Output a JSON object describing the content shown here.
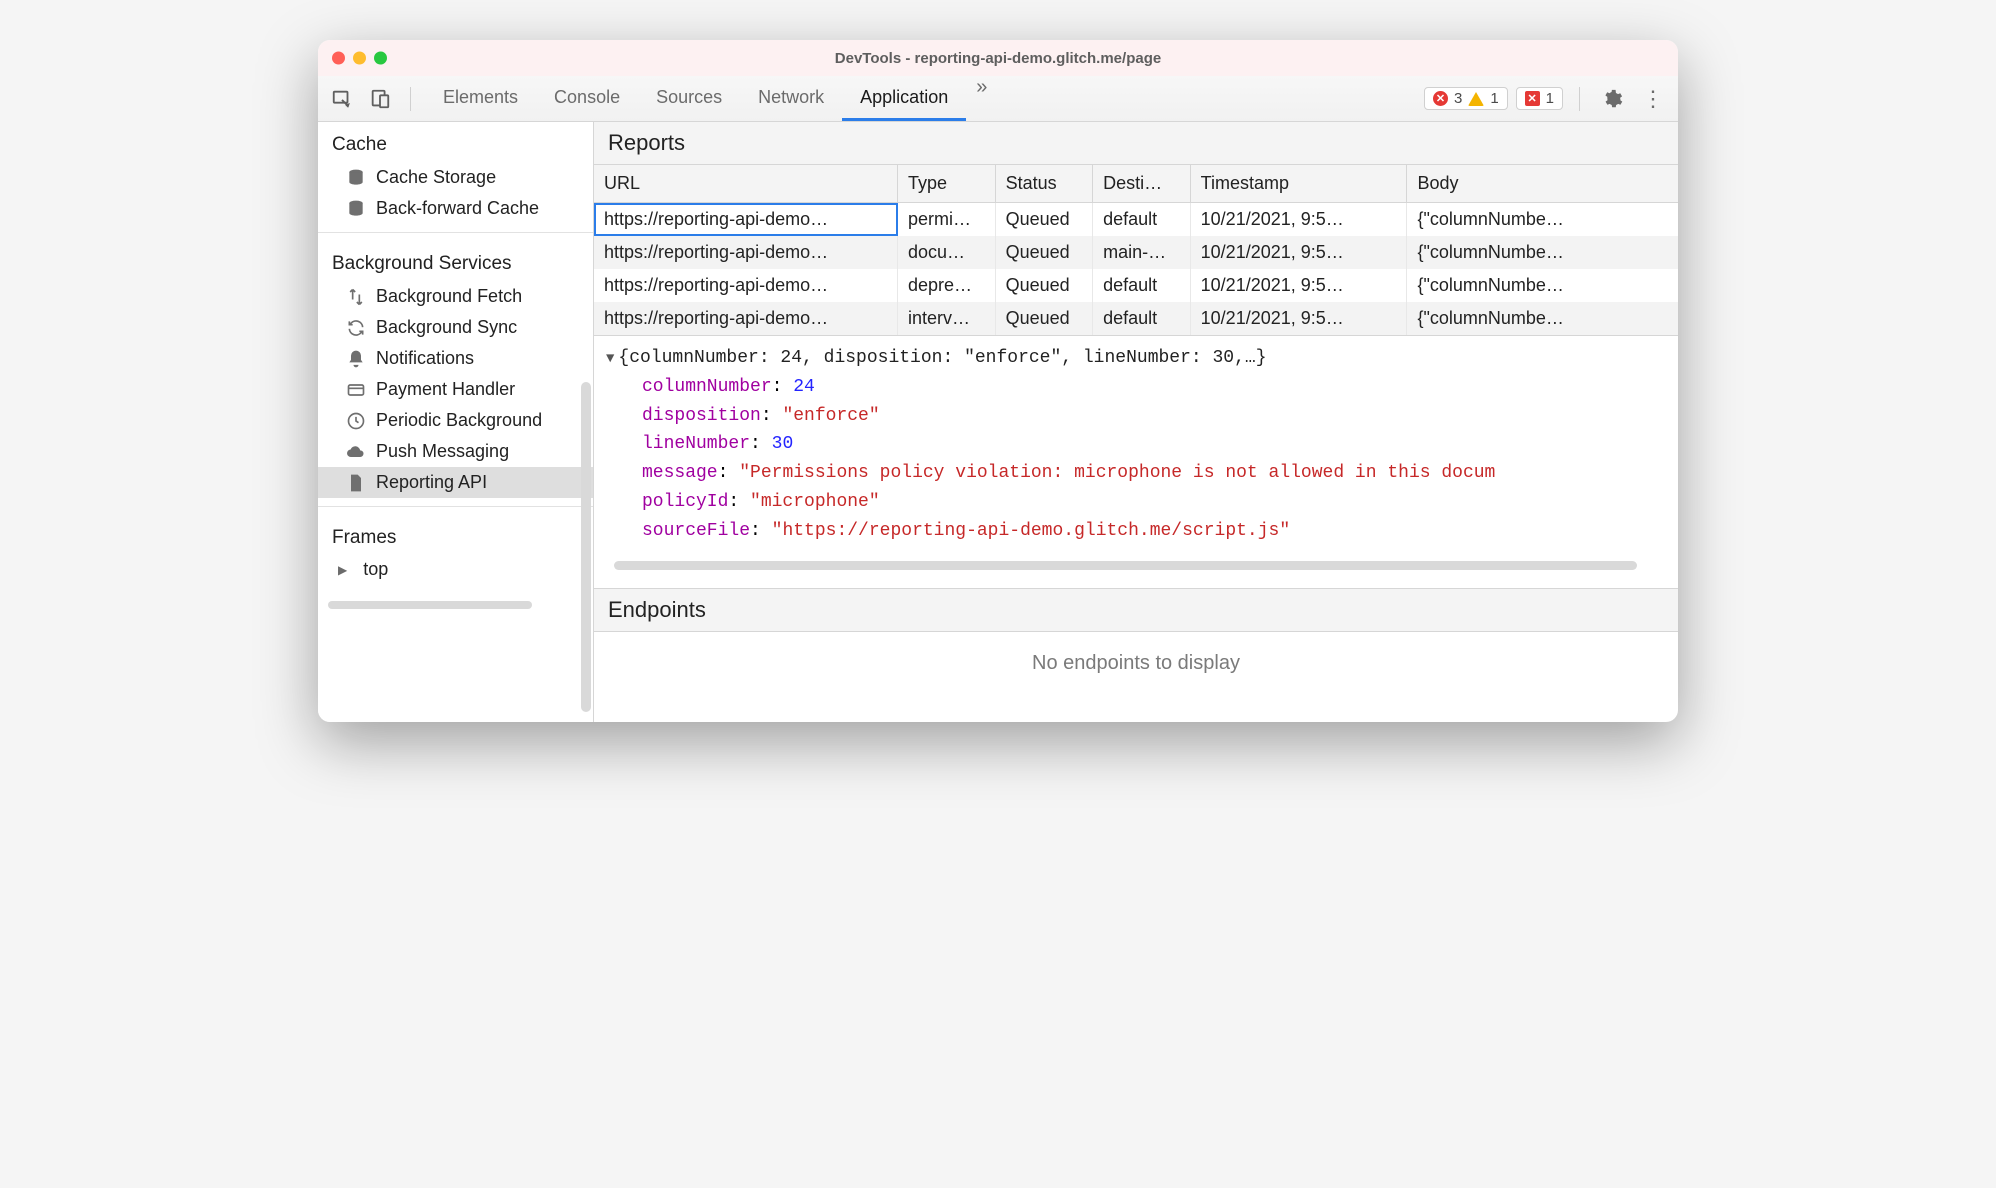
{
  "window": {
    "title": "DevTools - reporting-api-demo.glitch.me/page"
  },
  "toolbar": {
    "tabs": [
      "Elements",
      "Console",
      "Sources",
      "Network",
      "Application"
    ],
    "active_tab_index": 4,
    "overflow_glyph": "»",
    "error_count": "3",
    "warn_count": "1",
    "issue_count": "1"
  },
  "sidebar": {
    "sections": [
      {
        "title": "Cache",
        "items": [
          {
            "label": "Cache Storage",
            "icon": "database-icon"
          },
          {
            "label": "Back-forward Cache",
            "icon": "database-icon"
          }
        ]
      },
      {
        "title": "Background Services",
        "items": [
          {
            "label": "Background Fetch",
            "icon": "transfer-icon"
          },
          {
            "label": "Background Sync",
            "icon": "sync-icon"
          },
          {
            "label": "Notifications",
            "icon": "bell-icon"
          },
          {
            "label": "Payment Handler",
            "icon": "card-icon"
          },
          {
            "label": "Periodic Background",
            "icon": "clock-icon"
          },
          {
            "label": "Push Messaging",
            "icon": "cloud-icon"
          },
          {
            "label": "Reporting API",
            "icon": "file-icon",
            "active": true
          }
        ]
      }
    ],
    "frames_title": "Frames",
    "frames_top": "top"
  },
  "reports": {
    "title": "Reports",
    "columns": [
      "URL",
      "Type",
      "Status",
      "Desti…",
      "Timestamp",
      "Body"
    ],
    "rows": [
      {
        "url": "https://reporting-api-demo…",
        "type": "permi…",
        "status": "Queued",
        "dest": "default",
        "ts": "10/21/2021, 9:5…",
        "body": "{\"columnNumbe…",
        "selected_col0": true
      },
      {
        "url": "https://reporting-api-demo…",
        "type": "docu…",
        "status": "Queued",
        "dest": "main-…",
        "ts": "10/21/2021, 9:5…",
        "body": "{\"columnNumbe…"
      },
      {
        "url": "https://reporting-api-demo…",
        "type": "depre…",
        "status": "Queued",
        "dest": "default",
        "ts": "10/21/2021, 9:5…",
        "body": "{\"columnNumbe…"
      },
      {
        "url": "https://reporting-api-demo…",
        "type": "interv…",
        "status": "Queued",
        "dest": "default",
        "ts": "10/21/2021, 9:5…",
        "body": "{\"columnNumbe…"
      }
    ]
  },
  "detail": {
    "summary": "{columnNumber: 24, disposition: \"enforce\", lineNumber: 30,…}",
    "fields": {
      "columnNumber": 24,
      "disposition": "\"enforce\"",
      "lineNumber": 30,
      "message": "\"Permissions policy violation: microphone is not allowed in this docum",
      "policyId": "\"microphone\"",
      "sourceFile": "\"https://reporting-api-demo.glitch.me/script.js\""
    }
  },
  "endpoints": {
    "title": "Endpoints",
    "empty": "No endpoints to display"
  }
}
